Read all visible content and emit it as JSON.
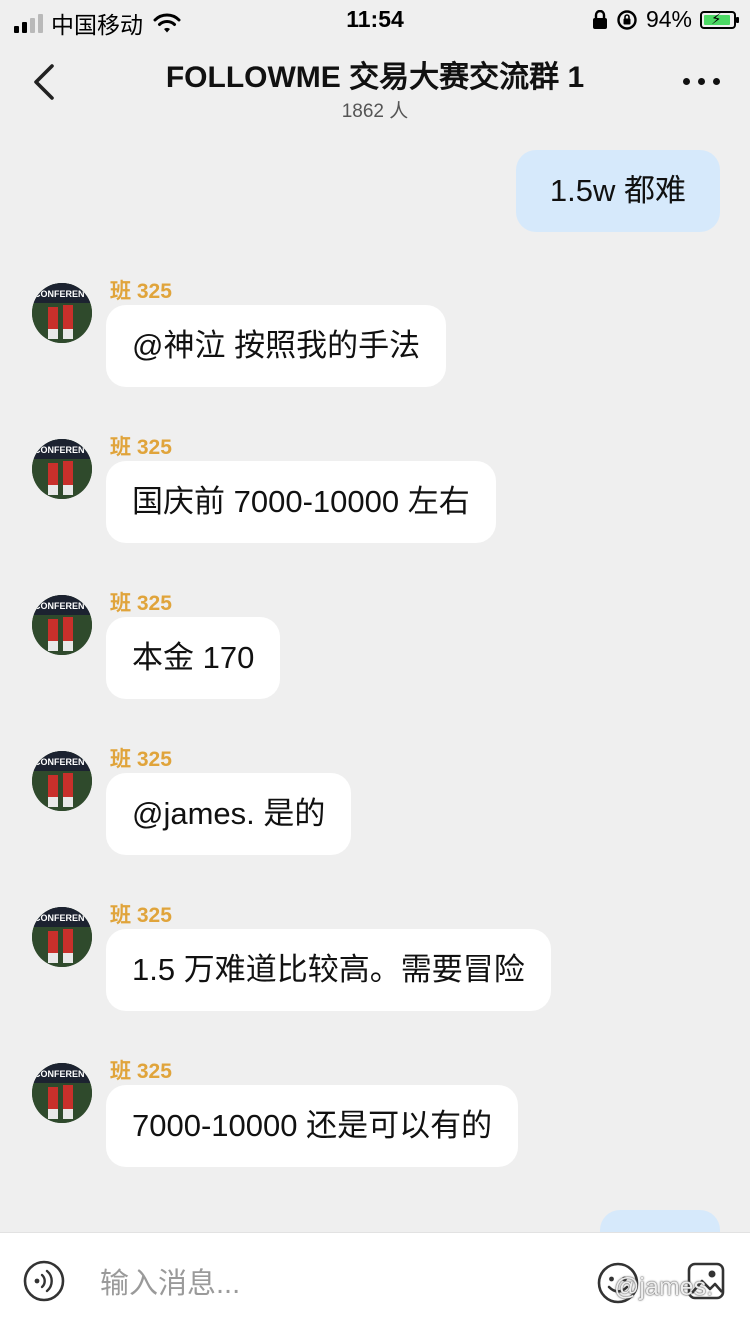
{
  "status_bar": {
    "carrier": "中国移动",
    "time": "11:54",
    "battery_percent": "94%",
    "battery_level": 0.94,
    "battery_color": "#4cd964"
  },
  "header": {
    "title": "FOLLOWME 交易大赛交流群 1",
    "member_count": "1862 人",
    "back_icon": "chevron-left-icon",
    "more_icon": "more-dots-icon"
  },
  "messages": [
    {
      "direction": "outgoing",
      "text": "1.5w 都难"
    },
    {
      "direction": "incoming",
      "sender": "班 325",
      "text": "@神泣 按照我的手法"
    },
    {
      "direction": "incoming",
      "sender": "班 325",
      "text": "国庆前 7000-10000 左右"
    },
    {
      "direction": "incoming",
      "sender": "班 325",
      "text": "本金 170"
    },
    {
      "direction": "incoming",
      "sender": "班 325",
      "text": "@james. 是的"
    },
    {
      "direction": "incoming",
      "sender": "班 325",
      "text": "1.5 万难道比较高。需要冒险"
    },
    {
      "direction": "incoming",
      "sender": "班 325",
      "text": "7000-10000 还是可以有的"
    },
    {
      "direction": "outgoing",
      "text": ""
    }
  ],
  "input_bar": {
    "placeholder": "输入消息...",
    "voice_icon": "voice-icon",
    "emoji_icon": "emoji-icon",
    "image_icon": "image-icon",
    "watermark": "@james."
  },
  "colors": {
    "background": "#efefef",
    "outgoing_bubble": "#d6e9fb",
    "incoming_bubble": "#ffffff",
    "sender_name": "#e0a43b"
  }
}
